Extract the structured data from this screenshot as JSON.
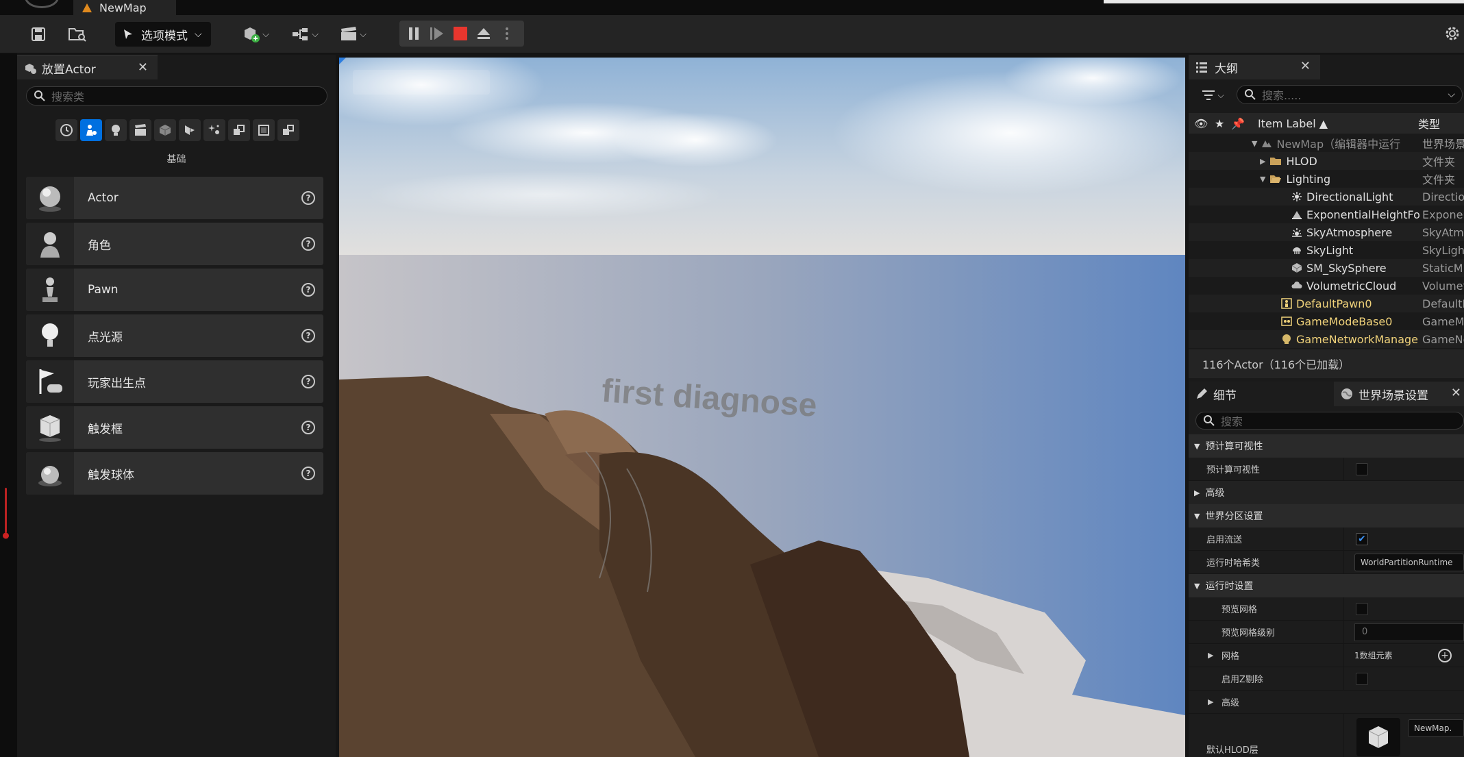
{
  "window": {
    "map_tab": "NewMap"
  },
  "toolbar": {
    "mode_label": "选项模式",
    "icons": [
      "save-icon",
      "content-browser-icon",
      "add-actor-icon",
      "blueprint-icon",
      "cinematics-icon",
      "pause-icon",
      "step-icon",
      "stop-icon",
      "eject-icon",
      "more-icon",
      "settings-icon"
    ]
  },
  "place_actor": {
    "tab_label": "放置Actor",
    "search_placeholder": "搜索类",
    "category_label": "基础",
    "items": [
      {
        "label": "Actor",
        "icon": "sphere-icon"
      },
      {
        "label": "角色",
        "icon": "character-icon"
      },
      {
        "label": "Pawn",
        "icon": "pawn-icon"
      },
      {
        "label": "点光源",
        "icon": "point-light-icon"
      },
      {
        "label": "玩家出生点",
        "icon": "player-start-icon"
      },
      {
        "label": "触发框",
        "icon": "trigger-box-icon"
      },
      {
        "label": "触发球体",
        "icon": "trigger-sphere-icon"
      }
    ]
  },
  "viewport": {
    "overlay_text": "first diagnose"
  },
  "outliner": {
    "tab_label": "大纲",
    "search_placeholder": "搜索.....",
    "col_label": "Item Label ▲",
    "col_type": "类型",
    "rows": [
      {
        "name": "NewMap（编辑器中运行",
        "type": "世界场景",
        "indent": 108,
        "icon": "map-icon",
        "style": "dim"
      },
      {
        "name": "HLOD",
        "type": "文件夹",
        "indent": 120,
        "icon": "folder-icon",
        "style": "normal"
      },
      {
        "name": "Lighting",
        "type": "文件夹",
        "indent": 120,
        "icon": "folder-open-icon",
        "style": "normal"
      },
      {
        "name": "DirectionalLight",
        "type": "Directio",
        "indent": 150,
        "icon": "directional-light-icon",
        "style": "normal"
      },
      {
        "name": "ExponentialHeightFo",
        "type": "Exponen",
        "indent": 150,
        "icon": "fog-icon",
        "style": "normal"
      },
      {
        "name": "SkyAtmosphere",
        "type": "SkyAtmo",
        "indent": 150,
        "icon": "sky-atmosphere-icon",
        "style": "normal"
      },
      {
        "name": "SkyLight",
        "type": "SkyLigh",
        "indent": 150,
        "icon": "skylight-icon",
        "style": "normal"
      },
      {
        "name": "SM_SkySphere",
        "type": "StaticM",
        "indent": 150,
        "icon": "static-mesh-icon",
        "style": "normal"
      },
      {
        "name": "VolumetricCloud",
        "type": "Volumet",
        "indent": 150,
        "icon": "cloud-icon",
        "style": "normal"
      },
      {
        "name": "DefaultPawn0",
        "type": "DefaultP",
        "indent": 135,
        "icon": "pawn-icon",
        "style": "yellow"
      },
      {
        "name": "GameModeBase0",
        "type": "GameMo",
        "indent": 135,
        "icon": "gamemode-icon",
        "style": "yellow"
      },
      {
        "name": "GameNetworkManage",
        "type": "GameNe",
        "indent": 135,
        "icon": "network-icon",
        "style": "yellow"
      }
    ],
    "actor_count": "116个Actor（116个已加载）"
  },
  "details": {
    "tab_details": "细节",
    "tab_world": "世界场景设置",
    "search_placeholder": "搜索",
    "sec_precomputed": "预计算可视性",
    "prop_precomputed": "预计算可视性",
    "sec_advanced1": "高级",
    "sec_partition": "世界分区设置",
    "prop_streaming": "启用流送",
    "prop_hash_class": "运行时哈希类",
    "hash_value": "WorldPartitionRuntime",
    "sec_runtime": "运行时设置",
    "prop_preview_grid": "预览网格",
    "prop_preview_level": "预览网格级别",
    "preview_level_value": "0",
    "prop_grid": "网格",
    "grid_value": "1数组元素",
    "prop_zcull": "启用Z剔除",
    "sec_advanced2": "高级",
    "prop_hlod": "默认HLOD层",
    "hlod_value": "NewMap."
  }
}
